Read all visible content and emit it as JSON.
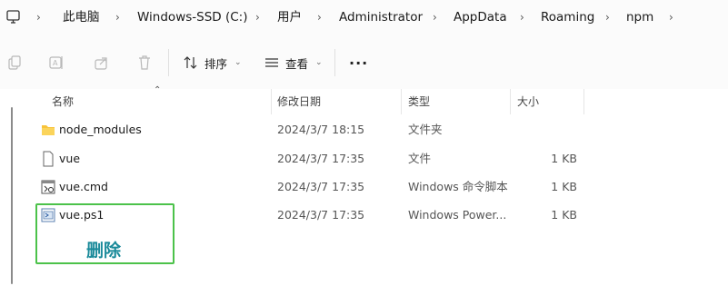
{
  "breadcrumb": {
    "items": [
      "此电脑",
      "Windows-SSD (C:)",
      "用户",
      "Administrator",
      "AppData",
      "Roaming",
      "npm"
    ]
  },
  "toolbar": {
    "sort_label": "排序",
    "view_label": "查看",
    "more_label": "···"
  },
  "columns": {
    "name": "名称",
    "date": "修改日期",
    "type": "类型",
    "size": "大小"
  },
  "files": [
    {
      "name": "node_modules",
      "date": "2024/3/7 18:15",
      "type": "文件夹",
      "size": "",
      "icon": "folder-icon"
    },
    {
      "name": "vue",
      "date": "2024/3/7 17:35",
      "type": "文件",
      "size": "1 KB",
      "icon": "file-icon"
    },
    {
      "name": "vue.cmd",
      "date": "2024/3/7 17:35",
      "type": "Windows 命令脚本",
      "size": "1 KB",
      "icon": "cmd-script-icon"
    },
    {
      "name": "vue.ps1",
      "date": "2024/3/7 17:35",
      "type": "Windows Power...",
      "size": "1 KB",
      "icon": "powershell-script-icon"
    }
  ],
  "annotation": {
    "text": "删除",
    "box_color": "#4cc24a",
    "text_color": "#1a8a9a"
  }
}
